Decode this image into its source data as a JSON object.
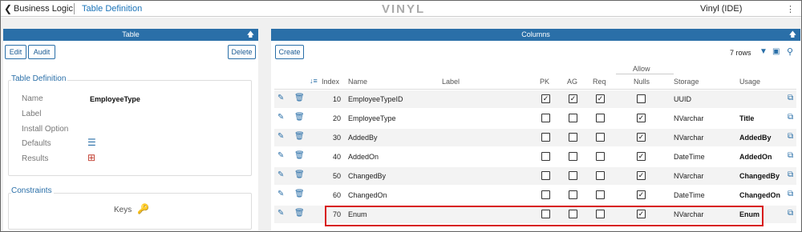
{
  "topbar": {
    "back_icon": "chevron-left-icon",
    "crumb1": "Business Logic",
    "crumb2": "Table Definition",
    "logo": "VINYL",
    "app_name": "Vinyl (IDE)",
    "menu_icon": "menu-icon"
  },
  "table_panel": {
    "title": "Table",
    "buttons": {
      "edit": "Edit",
      "audit": "Audit",
      "delete": "Delete"
    },
    "definition": {
      "title": "Table Definition",
      "name_label": "Name",
      "name_value": "EmployeeType",
      "label_label": "Label",
      "install_label": "Install Option",
      "defaults_label": "Defaults",
      "results_label": "Results"
    },
    "constraints": {
      "title": "Constraints",
      "keys": "Keys"
    }
  },
  "columns_panel": {
    "title": "Columns",
    "create": "Create",
    "row_count": "7 rows",
    "headers": {
      "index": "Index",
      "name": "Name",
      "label": "Label",
      "pk": "PK",
      "ag": "AG",
      "req": "Req",
      "allow": "Allow",
      "nulls": "Nulls",
      "storage": "Storage",
      "usage": "Usage"
    },
    "rows": [
      {
        "index": "10",
        "name": "EmployeeTypeID",
        "label": "",
        "pk": true,
        "ag": true,
        "req": true,
        "nulls": false,
        "storage": "UUID",
        "usage": ""
      },
      {
        "index": "20",
        "name": "EmployeeType",
        "label": "",
        "pk": false,
        "ag": false,
        "req": false,
        "nulls": true,
        "storage": "NVarchar",
        "usage": "Title"
      },
      {
        "index": "30",
        "name": "AddedBy",
        "label": "",
        "pk": false,
        "ag": false,
        "req": false,
        "nulls": true,
        "storage": "NVarchar",
        "usage": "AddedBy"
      },
      {
        "index": "40",
        "name": "AddedOn",
        "label": "",
        "pk": false,
        "ag": false,
        "req": false,
        "nulls": true,
        "storage": "DateTime",
        "usage": "AddedOn"
      },
      {
        "index": "50",
        "name": "ChangedBy",
        "label": "",
        "pk": false,
        "ag": false,
        "req": false,
        "nulls": true,
        "storage": "NVarchar",
        "usage": "ChangedBy"
      },
      {
        "index": "60",
        "name": "ChangedOn",
        "label": "",
        "pk": false,
        "ag": false,
        "req": false,
        "nulls": true,
        "storage": "DateTime",
        "usage": "ChangedOn"
      },
      {
        "index": "70",
        "name": "Enum",
        "label": "",
        "pk": false,
        "ag": false,
        "req": false,
        "nulls": true,
        "storage": "NVarchar",
        "usage": "Enum"
      }
    ]
  },
  "colors": {
    "header_blue": "#2a6fa8",
    "highlight_red": "#d81b1b"
  }
}
